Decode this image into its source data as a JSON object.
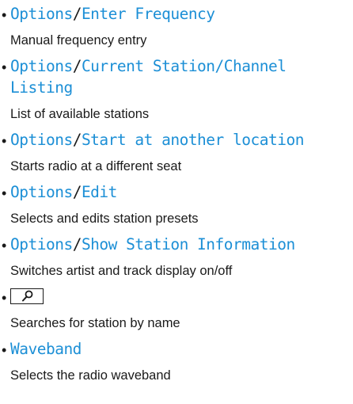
{
  "items": [
    {
      "path": [
        "Options",
        "Enter Frequency"
      ],
      "description": "Manual frequency entry"
    },
    {
      "path": [
        "Options",
        "Current Station/Channel Listing"
      ],
      "path_line1_tail": "Current Station/Channel",
      "path_line2": "Listing",
      "description": "List of available stations"
    },
    {
      "path": [
        "Options",
        "Start at another location"
      ],
      "description": "Starts radio at a different seat"
    },
    {
      "path": [
        "Options",
        "Edit"
      ],
      "description": "Selects and edits station presets"
    },
    {
      "path": [
        "Options",
        "Show Station Information"
      ],
      "description": "Switches artist and track display on/off"
    },
    {
      "icon": "search-icon",
      "description": "Searches for station by name"
    },
    {
      "path": [
        "Waveband"
      ],
      "description": "Selects the radio waveband"
    }
  ],
  "separator": "/",
  "bullet": "•",
  "colors": {
    "link": "#1c8fd6",
    "text": "#1a1a1a"
  }
}
